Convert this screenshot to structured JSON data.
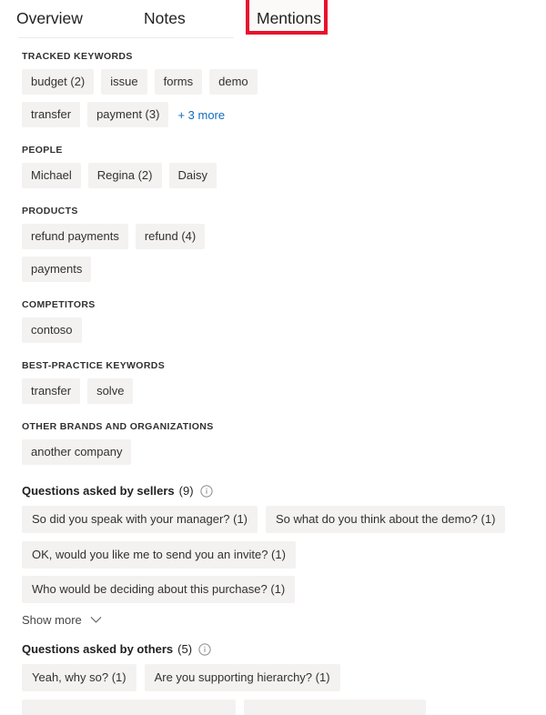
{
  "tabs": [
    {
      "label": "Overview",
      "selected": false
    },
    {
      "label": "Notes",
      "selected": false
    },
    {
      "label": "Mentions",
      "selected": true
    }
  ],
  "annotation": {
    "type": "highlight-rectangle",
    "color": "#e8112d",
    "target": "Mentions"
  },
  "colors": {
    "pill_background": "#f3f2f1",
    "link": "#0f6cbd",
    "text": "#201f1e",
    "annotation": "#e8112d"
  },
  "sections": [
    {
      "heading": "TRACKED KEYWORDS",
      "pills": [
        "budget (2)",
        "issue",
        "forms",
        "demo",
        "transfer",
        "payment (3)"
      ],
      "more_link": "+ 3 more"
    },
    {
      "heading": "PEOPLE",
      "pills": [
        "Michael",
        "Regina (2)",
        "Daisy"
      ],
      "more_link": null
    },
    {
      "heading": "PRODUCTS",
      "pills": [
        "refund payments",
        "refund (4)",
        "payments"
      ],
      "more_link": null
    },
    {
      "heading": "COMPETITORS",
      "pills": [
        "contoso"
      ],
      "more_link": null
    },
    {
      "heading": "BEST-PRACTICE KEYWORDS",
      "pills": [
        "transfer",
        "solve"
      ],
      "more_link": null
    },
    {
      "heading": "OTHER BRANDS AND ORGANIZATIONS",
      "pills": [
        "another company"
      ],
      "more_link": null
    }
  ],
  "questions_sellers": {
    "title": "Questions asked by sellers",
    "count": "(9)",
    "info_icon": "info-icon",
    "pills": [
      "So did you speak with your manager? (1)",
      "So what do you think about the demo? (1)",
      "OK, would you like me to send you an invite? (1)",
      "Who would be deciding about this purchase? (1)"
    ],
    "show_more_label": "Show more",
    "show_more_icon": "chevron-down-icon"
  },
  "questions_others": {
    "title": "Questions asked by others",
    "count": "(5)",
    "info_icon": "info-icon",
    "pills": [
      "Yeah, why so? (1)",
      "Are you supporting hierarchy? (1)"
    ],
    "partial_row": [
      "",
      ""
    ]
  }
}
